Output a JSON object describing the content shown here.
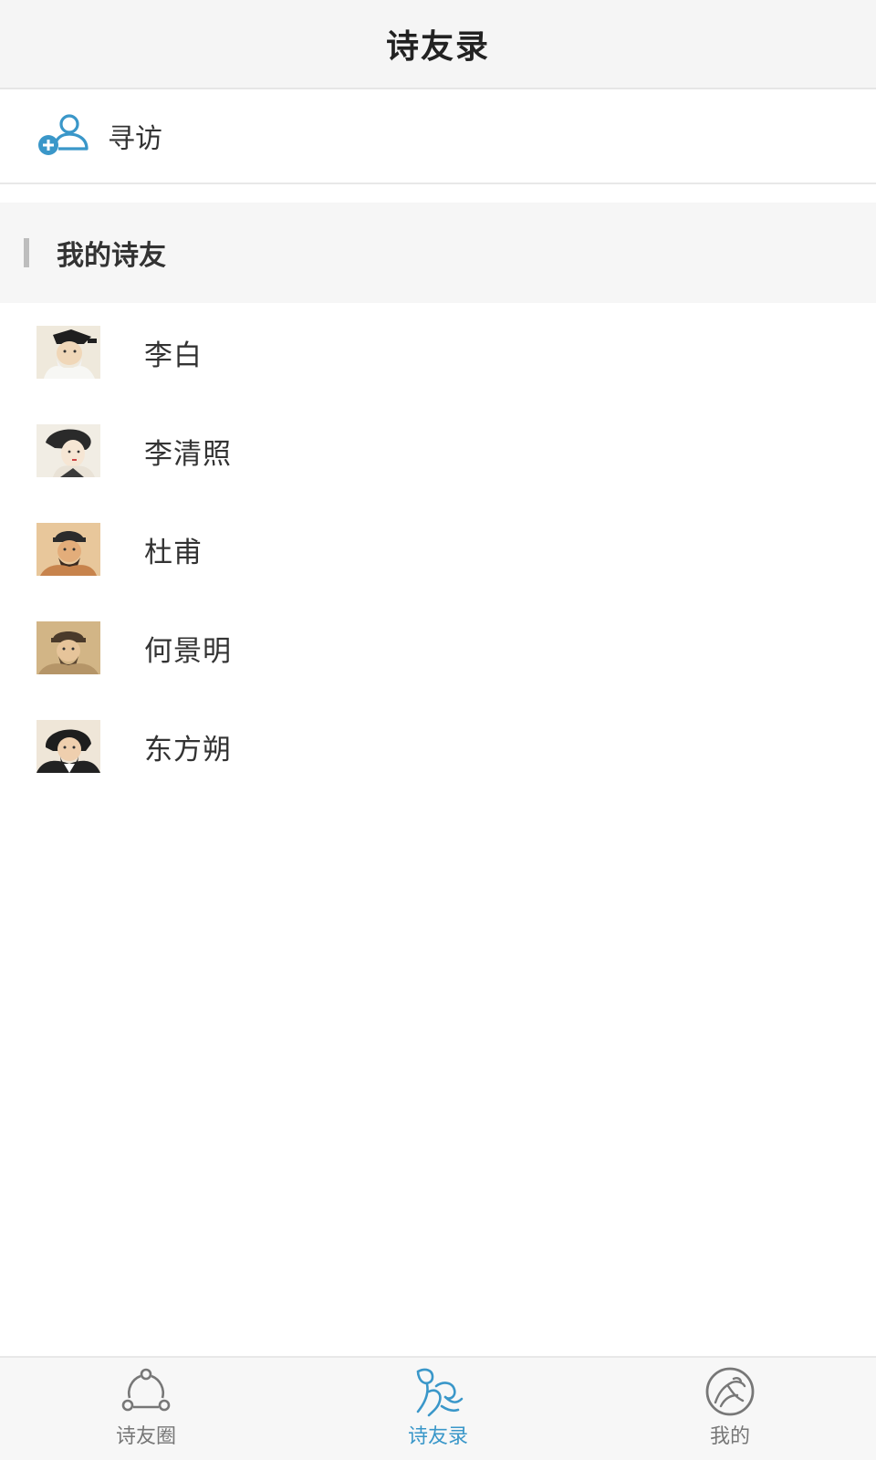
{
  "header": {
    "title": "诗友录"
  },
  "search": {
    "label": "寻访",
    "icon": "add-user-icon"
  },
  "section": {
    "title": "我的诗友"
  },
  "friends": [
    {
      "name": "李白",
      "avatar": "li-bai-avatar"
    },
    {
      "name": "李清照",
      "avatar": "li-qingzhao-avatar"
    },
    {
      "name": "杜甫",
      "avatar": "du-fu-avatar"
    },
    {
      "name": "何景明",
      "avatar": "he-jingming-avatar"
    },
    {
      "name": "东方朔",
      "avatar": "dongfang-shuo-avatar"
    }
  ],
  "tabbar": {
    "tabs": [
      {
        "label": "诗友圈",
        "icon": "circle-network-icon",
        "active": false
      },
      {
        "label": "诗友录",
        "icon": "poet-figure-icon",
        "active": true
      },
      {
        "label": "我的",
        "icon": "profile-emblem-icon",
        "active": false
      }
    ]
  },
  "colors": {
    "accent": "#3a97c9",
    "header_bg": "#f5f5f5",
    "section_bg": "#f6f6f6",
    "text": "#333333",
    "tab_inactive": "#777777"
  }
}
